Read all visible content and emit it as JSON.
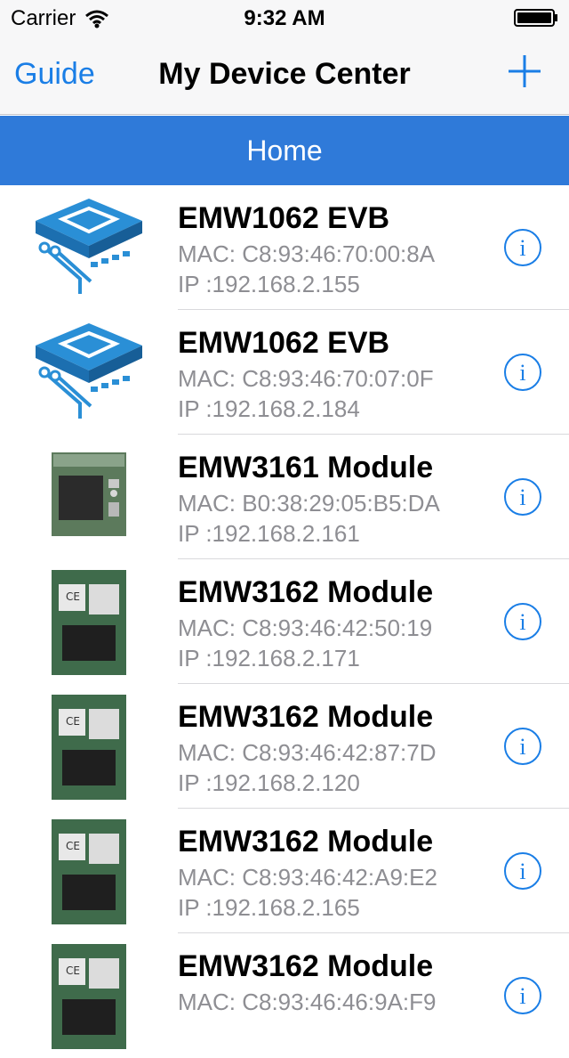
{
  "status": {
    "carrier": "Carrier",
    "time": "9:32 AM"
  },
  "nav": {
    "left": "Guide",
    "title": "My Device Center",
    "add_icon": "plus-icon"
  },
  "section": {
    "title": "Home"
  },
  "colors": {
    "accent": "#1a7ee6",
    "section_bg": "#2f7ad9"
  },
  "devices": [
    {
      "name": "EMW1062 EVB",
      "mac": "MAC: C8:93:46:70:00:8A",
      "ip": "IP :192.168.2.155",
      "icon": "chip-icon"
    },
    {
      "name": "EMW1062 EVB",
      "mac": "MAC: C8:93:46:70:07:0F",
      "ip": "IP :192.168.2.184",
      "icon": "chip-icon"
    },
    {
      "name": "EMW3161 Module",
      "mac": "MAC: B0:38:29:05:B5:DA",
      "ip": "IP :192.168.2.161",
      "icon": "module-square-icon"
    },
    {
      "name": "EMW3162 Module",
      "mac": "MAC: C8:93:46:42:50:19",
      "ip": "IP :192.168.2.171",
      "icon": "module-board-icon"
    },
    {
      "name": "EMW3162 Module",
      "mac": "MAC: C8:93:46:42:87:7D",
      "ip": "IP :192.168.2.120",
      "icon": "module-board-icon"
    },
    {
      "name": "EMW3162 Module",
      "mac": "MAC: C8:93:46:42:A9:E2",
      "ip": "IP :192.168.2.165",
      "icon": "module-board-icon"
    },
    {
      "name": "EMW3162 Module",
      "mac": "MAC: C8:93:46:46:9A:F9",
      "ip": "",
      "icon": "module-board-icon"
    }
  ]
}
